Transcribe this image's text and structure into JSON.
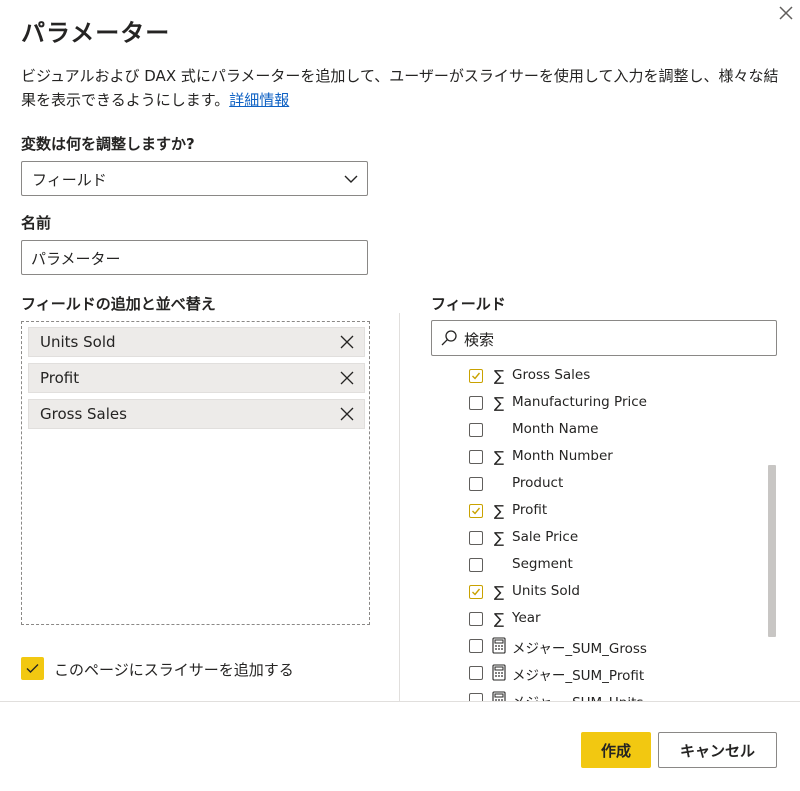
{
  "dialog": {
    "title": "パラメーター",
    "description": "ビジュアルおよび DAX 式にパラメーターを追加して、ユーザーがスライサーを使用して入力を調整し、様々な結果を表示できるようにします。",
    "learn_more": "詳細情報"
  },
  "variable": {
    "label": "変数は何を調整しますか?",
    "value": "フィールド"
  },
  "name": {
    "label": "名前",
    "value": "パラメーター"
  },
  "wells": {
    "label": "フィールドの追加と並べ替え",
    "items": [
      {
        "label": "Units Sold"
      },
      {
        "label": "Profit"
      },
      {
        "label": "Gross Sales"
      }
    ]
  },
  "fields": {
    "label": "フィールド",
    "search_placeholder": "検索",
    "items": [
      {
        "label": "Gross Sales",
        "checked": true,
        "icon": "sigma-icon"
      },
      {
        "label": "Manufacturing Price",
        "checked": false,
        "icon": "sigma-icon"
      },
      {
        "label": "Month Name",
        "checked": false,
        "icon": "none"
      },
      {
        "label": "Month Number",
        "checked": false,
        "icon": "sigma-icon"
      },
      {
        "label": "Product",
        "checked": false,
        "icon": "none"
      },
      {
        "label": "Profit",
        "checked": true,
        "icon": "sigma-icon"
      },
      {
        "label": "Sale Price",
        "checked": false,
        "icon": "sigma-icon"
      },
      {
        "label": "Segment",
        "checked": false,
        "icon": "none"
      },
      {
        "label": "Units Sold",
        "checked": true,
        "icon": "sigma-icon"
      },
      {
        "label": "Year",
        "checked": false,
        "icon": "sigma-icon"
      },
      {
        "label": "メジャー_SUM_Gross",
        "checked": false,
        "icon": "calculator-icon"
      },
      {
        "label": "メジャー_SUM_Profit",
        "checked": false,
        "icon": "calculator-icon"
      },
      {
        "label": "メジャー_SUM_Units",
        "checked": false,
        "icon": "calculator-icon"
      }
    ]
  },
  "add_slicer": {
    "label": "このページにスライサーを追加する",
    "checked": true
  },
  "buttons": {
    "create": "作成",
    "cancel": "キャンセル"
  },
  "colors": {
    "accent": "#f2c811",
    "link": "#0f62c4",
    "check": "#c9a200"
  }
}
